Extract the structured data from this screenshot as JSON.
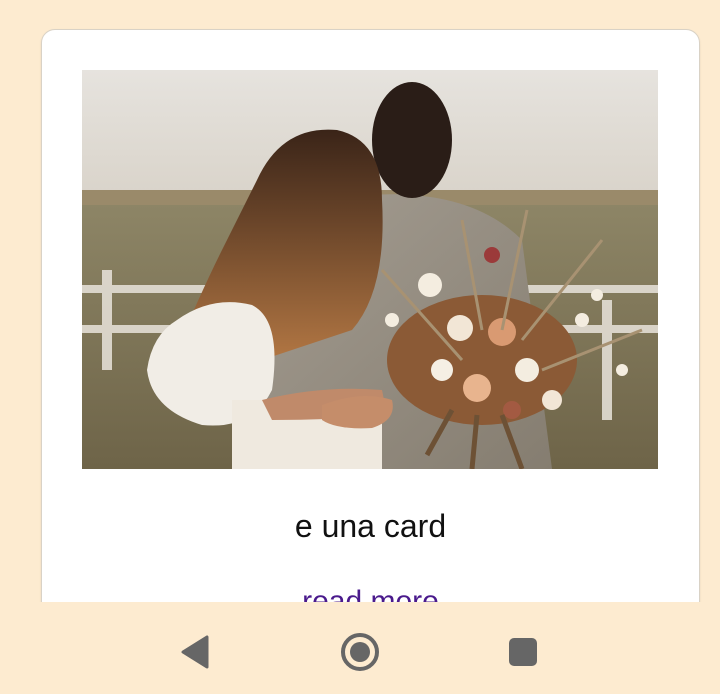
{
  "card": {
    "image_alt": "Couple embracing holding a dried flower bouquet in a field",
    "title": "e una card",
    "link_label": "read more"
  },
  "navbar": {
    "back_icon": "back-triangle-icon",
    "home_icon": "home-circle-icon",
    "recents_icon": "recents-square-icon"
  },
  "colors": {
    "background": "#fdebd0",
    "card": "#ffffff",
    "link": "#4a1a8c",
    "nav_icon": "#666666"
  }
}
